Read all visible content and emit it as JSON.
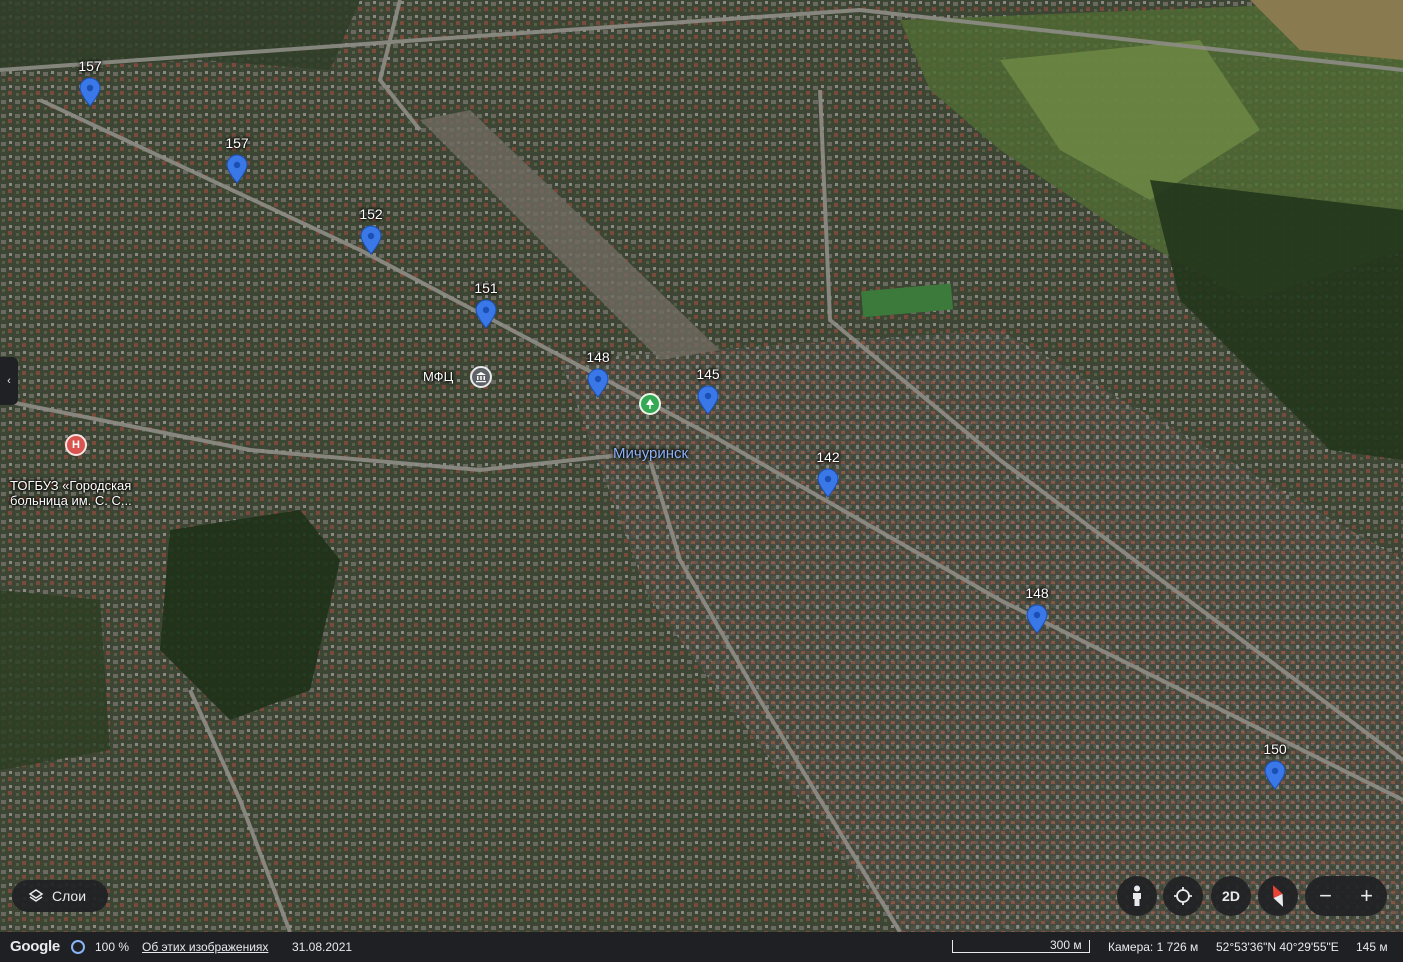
{
  "map": {
    "city_label": "Мичуринск",
    "markers": [
      {
        "number": "157"
      },
      {
        "number": "157"
      },
      {
        "number": "152"
      },
      {
        "number": "151"
      },
      {
        "number": "148"
      },
      {
        "number": "145"
      },
      {
        "number": "142"
      },
      {
        "number": "148"
      },
      {
        "number": "150"
      }
    ],
    "pois": {
      "mfc": {
        "label": "МФЦ",
        "icon": "government-building-icon"
      },
      "hospital": {
        "label": "ТОГБУЗ «Городская больница им. С. С...",
        "icon": "hospital-icon",
        "icon_letter": "H"
      },
      "park": {
        "icon": "park-tree-icon"
      }
    },
    "colors": {
      "marker": "#3b78e7",
      "hospital": "#d9534f",
      "park": "#34a853",
      "city_label": "#8ab4f8"
    }
  },
  "controls": {
    "side_panel_toggle": "‹",
    "layers_label": "Слои",
    "street_view_icon": "pegman-icon",
    "rotate_icon": "rotate-icon",
    "view_mode_label": "2D",
    "compass_icon": "compass-icon",
    "zoom_out": "−",
    "zoom_in": "+"
  },
  "footer": {
    "logo": "Google",
    "opacity_value": "100 %",
    "about_images": "Об этих изображениях",
    "date": "31.08.2021",
    "scale_label": "300 м",
    "camera": "Камера: 1 726 м",
    "coordinates": "52°53'36\"N 40°29'55\"E",
    "elevation": "145 м"
  }
}
